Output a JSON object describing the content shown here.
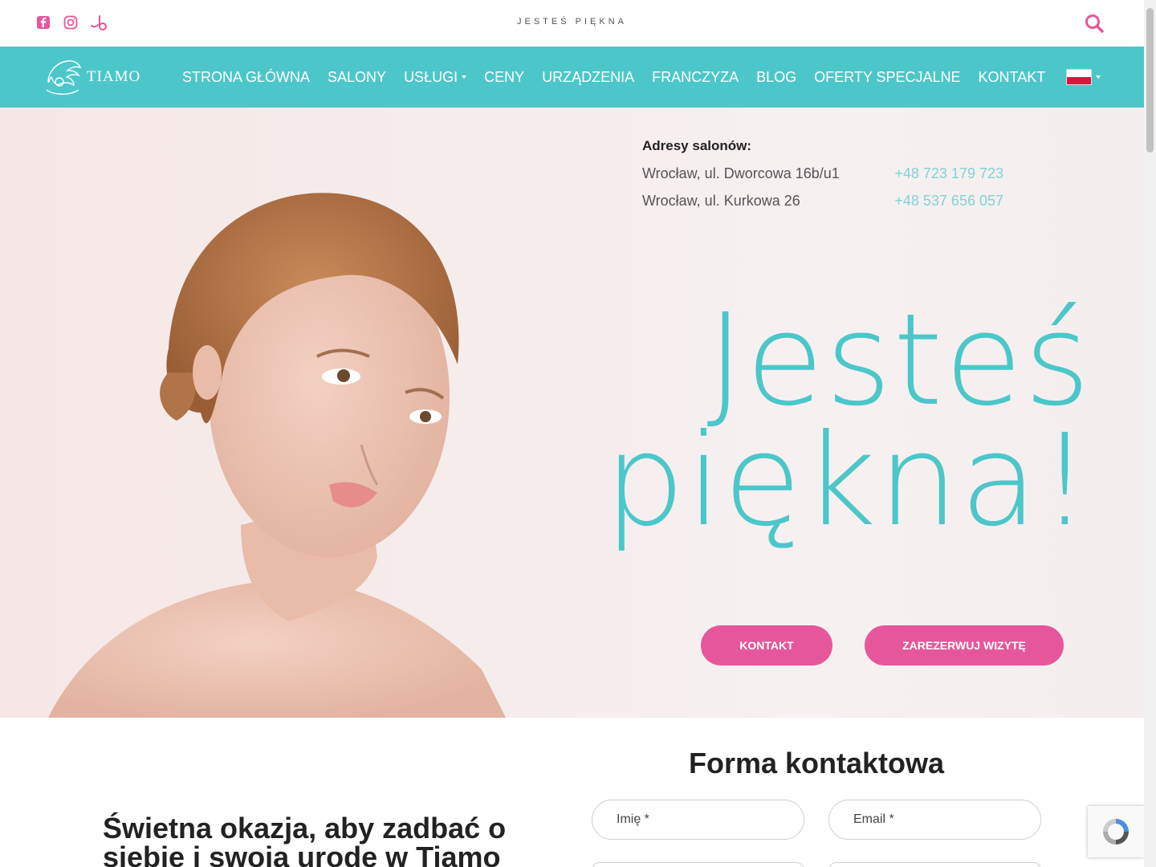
{
  "topbar": {
    "tagline": "JESTEŚ PIĘKNA",
    "social_icons": [
      "facebook-icon",
      "instagram-icon",
      "booksy-icon"
    ],
    "accent": "#e5579a"
  },
  "nav": {
    "logo_text": "TIAMO",
    "bg": "#4cc7c9",
    "items": [
      {
        "label": "STRONA GŁÓWNA"
      },
      {
        "label": "SALONY"
      },
      {
        "label": "USŁUGI"
      },
      {
        "label": "CENY"
      },
      {
        "label": "URZĄDZENIA"
      },
      {
        "label": "FRANCZYZA"
      },
      {
        "label": "BLOG"
      },
      {
        "label": "OFERTY SPECJALNE"
      },
      {
        "label": "KONTAKT"
      }
    ],
    "language_icon": "polish-flag-icon"
  },
  "hero": {
    "address_title": "Adresy salonów:",
    "addresses": [
      {
        "address": "Wrocław, ul. Dworcowa 16b/u1",
        "phone": "+48 723 179 723"
      },
      {
        "address": "Wrocław, ul. Kurkowa 26",
        "phone": "+48 537 656 057"
      }
    ],
    "headline_line1": "Jesteś",
    "headline_line2": "piękna!",
    "btn_contact": "KONTAKT",
    "btn_book": "ZAREZERWUJ WIZYTĘ"
  },
  "contact": {
    "title": "Forma kontaktowa",
    "name_placeholder": "Imię *",
    "email_placeholder": "Email *"
  },
  "promo": {
    "text": "Świetna okazja, aby zadbać o siebie i swoją urodę w Tiamo"
  }
}
